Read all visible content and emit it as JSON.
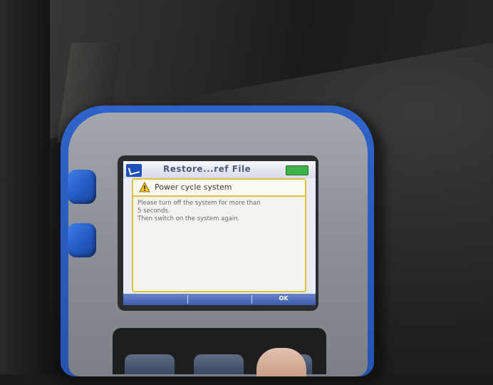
{
  "app": {
    "title": "Restore...ref File",
    "logo_icon": "app-logo-icon",
    "battery_icon": "battery-icon",
    "battery_color": "#3fb24a"
  },
  "dialog": {
    "icon": "warning-icon",
    "title": "Power cycle system",
    "lines": [
      "Please turn off the system for more than",
      "5 seconds.",
      "Then switch on the system again."
    ],
    "border_color": "#e0c33c"
  },
  "softkeys": {
    "left_label": "",
    "middle_label": "",
    "right_label": "OK"
  },
  "device": {
    "accent_color": "#2553b0",
    "body_color": "#8d9197"
  }
}
